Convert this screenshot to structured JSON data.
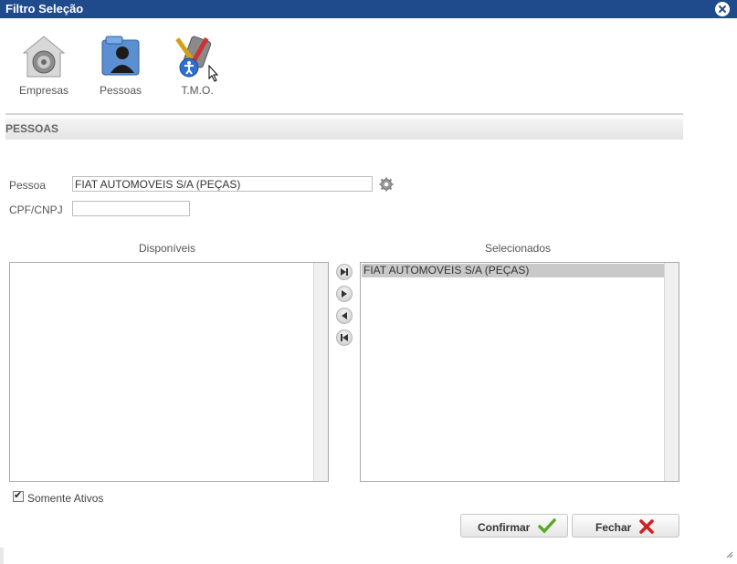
{
  "window": {
    "title": "Filtro Seleção"
  },
  "toolbar": {
    "items": [
      {
        "label": "Empresas",
        "icon": "building-lock-icon"
      },
      {
        "label": "Pessoas",
        "icon": "person-folder-icon"
      },
      {
        "label": "T.M.O.",
        "icon": "tools-accessibility-icon"
      }
    ]
  },
  "section": {
    "title": "PESSOAS"
  },
  "form": {
    "pessoa_label": "Pessoa",
    "pessoa_value": "FIAT AUTOMOVEIS S/A (PEÇAS)",
    "cpf_label": "CPF/CNPJ",
    "cpf_value": ""
  },
  "lists": {
    "available_title": "Disponíveis",
    "available_items": [],
    "selected_title": "Selecionados",
    "selected_items": [
      "FIAT AUTOMOVEIS S/A (PEÇAS)"
    ]
  },
  "options": {
    "only_active_label": "Somente Ativos",
    "only_active_checked": true
  },
  "buttons": {
    "confirm_label": "Confirmar",
    "close_label": "Fechar"
  },
  "colors": {
    "titlebar": "#1f4a8c",
    "confirm_icon": "#5aa82a",
    "close_icon": "#d11f1f"
  }
}
